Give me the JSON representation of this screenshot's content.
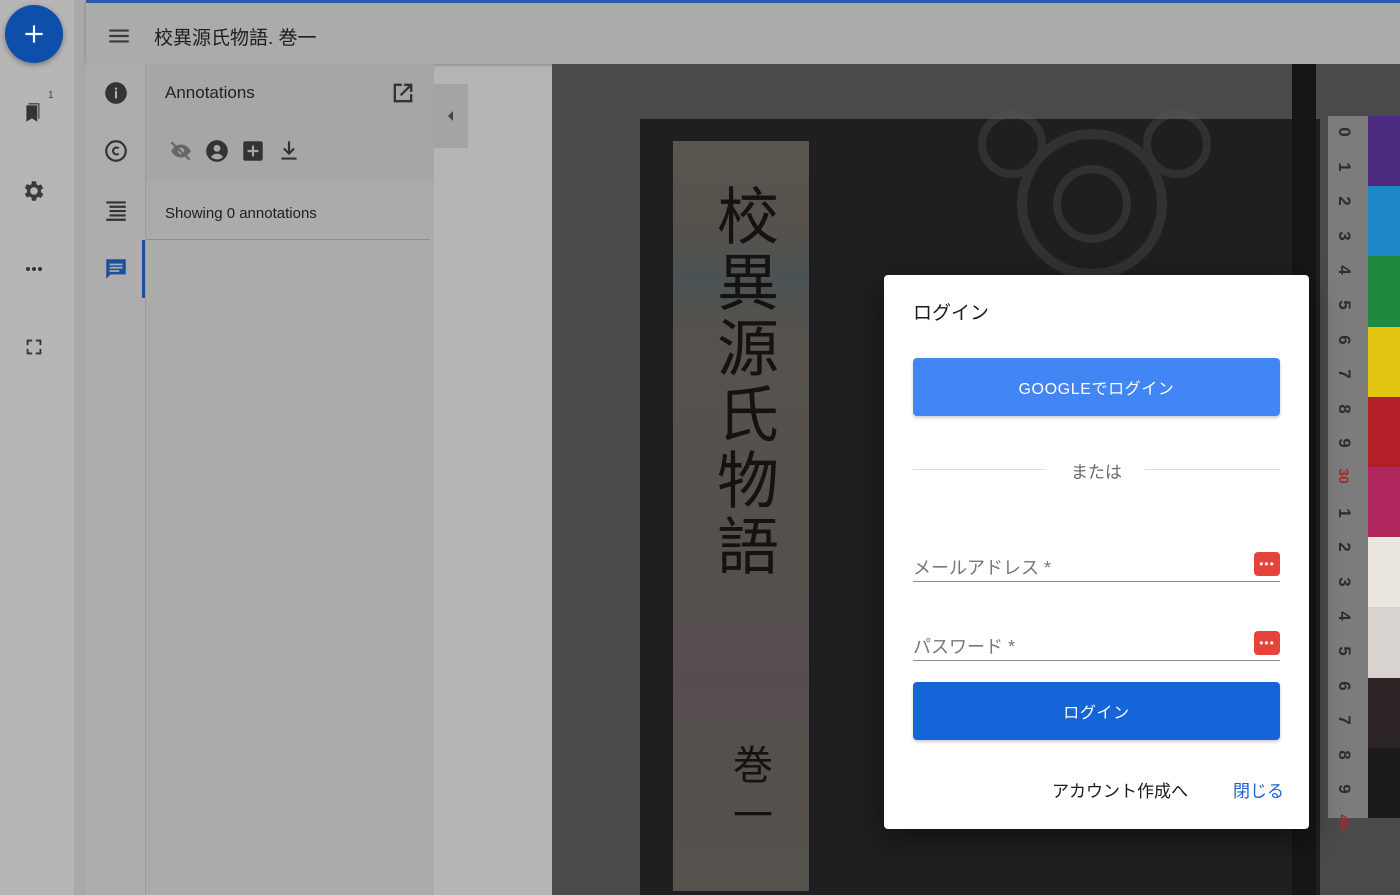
{
  "app": {
    "title": "校異源氏物語. 巻一"
  },
  "left_rail": {
    "add_button": "+",
    "bookmark_badge": "1",
    "icons": [
      "add-icon",
      "bookmark-icon",
      "gear-icon",
      "more-horiz-icon",
      "fullscreen-icon"
    ]
  },
  "companion_rail": {
    "icons": [
      "info-icon",
      "copyright-icon",
      "toc-icon",
      "annotations-icon"
    ]
  },
  "annotations_panel": {
    "title": "Annotations",
    "tools": [
      "visibility-off-icon",
      "account-circle-icon",
      "add-box-icon",
      "download-icon"
    ],
    "status": "Showing 0 annotations"
  },
  "viewer": {
    "book_label_title": "校異源氏物語",
    "book_label_volume": "巻一",
    "ruler_numbers": [
      "0",
      "1",
      "2",
      "3",
      "4",
      "5",
      "6",
      "7",
      "8",
      "9",
      "30",
      "1",
      "2",
      "3",
      "4",
      "5",
      "6",
      "7",
      "8",
      "9",
      "40"
    ],
    "swatch_colors": [
      "#4b2a80",
      "#1d86c6",
      "#1f8a3d",
      "#e3c612",
      "#b51f27",
      "#b0275d",
      "#ece6e0",
      "#d8d3cf",
      "#2c2327",
      "#1c1a1c"
    ]
  },
  "login_dialog": {
    "title": "ログイン",
    "google_button": "GOOGLEでログイン",
    "divider": "または",
    "email_label": "メールアドレス *",
    "password_label": "パスワード *",
    "login_button": "ログイン",
    "create_account": "アカウント作成へ",
    "close": "閉じる"
  }
}
